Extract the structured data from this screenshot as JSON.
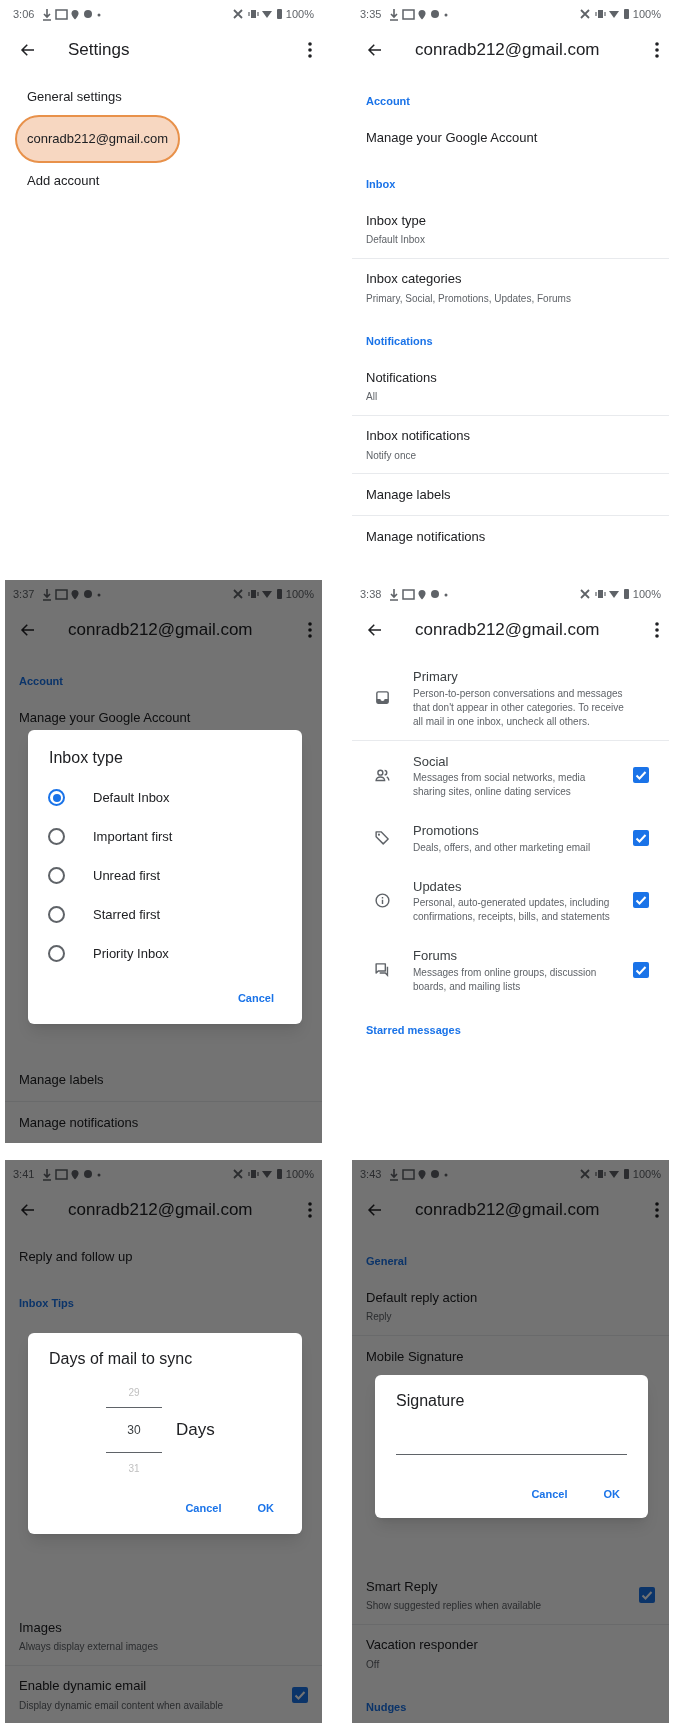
{
  "screens": [
    {
      "status_bar": {
        "time": "3:06",
        "battery": "100%"
      },
      "app_bar": {
        "title": "Settings"
      },
      "items": [
        {
          "kind": "account",
          "label": "General settings",
          "highlighted": false
        },
        {
          "kind": "account",
          "label": "conradb212@gmail.com",
          "highlighted": true
        },
        {
          "kind": "account",
          "label": "Add account",
          "highlighted": false
        }
      ]
    },
    {
      "status_bar": {
        "time": "3:35",
        "battery": "100%"
      },
      "app_bar": {
        "title": "conradb212@gmail.com"
      },
      "items": [
        {
          "kind": "section",
          "label": "Account"
        },
        {
          "kind": "setting",
          "label": "Manage your Google Account"
        },
        {
          "kind": "section",
          "label": "Inbox"
        },
        {
          "kind": "setting",
          "label": "Inbox type",
          "subtitle": "Default Inbox"
        },
        {
          "kind": "setting",
          "label": "Inbox categories",
          "subtitle": "Primary, Social, Promotions, Updates, Forums"
        },
        {
          "kind": "section",
          "label": "Notifications"
        },
        {
          "kind": "setting",
          "label": "Notifications",
          "subtitle": "All"
        },
        {
          "kind": "setting",
          "label": "Inbox notifications",
          "subtitle": "Notify once"
        },
        {
          "kind": "setting",
          "label": "Manage labels"
        },
        {
          "kind": "setting",
          "label": "Manage notifications"
        }
      ]
    },
    {
      "status_bar": {
        "time": "3:37",
        "battery": "100%"
      },
      "app_bar": {
        "title": "conradb212@gmail.com"
      },
      "items": [
        {
          "kind": "section",
          "label": "Account"
        },
        {
          "kind": "setting",
          "label": "Manage your Google Account"
        }
      ],
      "items_below": [
        {
          "kind": "setting",
          "label": "Manage labels"
        },
        {
          "kind": "setting",
          "label": "Manage notifications"
        }
      ],
      "dialog": {
        "kind": "radio",
        "title": "Inbox type",
        "options": [
          {
            "label": "Default Inbox",
            "selected": true
          },
          {
            "label": "Important first",
            "selected": false
          },
          {
            "label": "Unread first",
            "selected": false
          },
          {
            "label": "Starred first",
            "selected": false
          },
          {
            "label": "Priority Inbox",
            "selected": false
          }
        ],
        "buttons": [
          "Cancel"
        ]
      }
    },
    {
      "status_bar": {
        "time": "3:38",
        "battery": "100%"
      },
      "app_bar": {
        "title": "conradb212@gmail.com"
      },
      "items": [
        {
          "kind": "category",
          "label": "Primary",
          "subtitle": "Person-to-person conversations and messages that don't appear in other categories. To receive all mail in one inbox, uncheck all others."
        },
        {
          "kind": "category",
          "label": "Social",
          "subtitle": "Messages from social networks, media sharing sites, online dating services",
          "checked": true
        },
        {
          "kind": "category",
          "label": "Promotions",
          "subtitle": "Deals, offers, and other marketing email",
          "checked": true
        },
        {
          "kind": "category",
          "label": "Updates",
          "subtitle": "Personal, auto-generated updates, including confirmations, receipts, bills, and statements",
          "checked": true
        },
        {
          "kind": "category",
          "label": "Forums",
          "subtitle": "Messages from online groups, discussion boards, and mailing lists",
          "checked": true
        },
        {
          "kind": "section",
          "label": "Starred messages"
        }
      ]
    },
    {
      "status_bar": {
        "time": "3:41",
        "battery": "100%"
      },
      "app_bar": {
        "title": "conradb212@gmail.com"
      },
      "items": [
        {
          "kind": "setting",
          "label": "Reply and follow up"
        },
        {
          "kind": "section",
          "label": "Inbox Tips"
        }
      ],
      "items_below": [
        {
          "kind": "setting",
          "label": "Images",
          "subtitle": "Always display external images"
        },
        {
          "kind": "toggle",
          "label": "Enable dynamic email",
          "subtitle": "Display dynamic email content when available",
          "checked": true
        }
      ],
      "dialog": {
        "kind": "picker",
        "title": "Days of mail to sync",
        "values": [
          {
            "label": "29",
            "selected": false
          },
          {
            "label": "30",
            "selected": true
          },
          {
            "label": "31",
            "selected": false
          }
        ],
        "unit": "Days",
        "buttons": [
          "Cancel",
          "OK"
        ]
      }
    },
    {
      "status_bar": {
        "time": "3:43",
        "battery": "100%"
      },
      "app_bar": {
        "title": "conradb212@gmail.com"
      },
      "items": [
        {
          "kind": "section",
          "label": "General"
        },
        {
          "kind": "setting",
          "label": "Default reply action",
          "subtitle": "Reply"
        },
        {
          "kind": "setting",
          "label": "Mobile Signature"
        }
      ],
      "items_below": [
        {
          "kind": "toggle",
          "label": "Smart Reply",
          "subtitle": "Show suggested replies when available",
          "checked": true
        },
        {
          "kind": "setting",
          "label": "Vacation responder",
          "subtitle": "Off"
        },
        {
          "kind": "section",
          "label": "Nudges"
        }
      ],
      "dialog": {
        "kind": "text_input",
        "title": "Signature",
        "buttons": [
          "Cancel",
          "OK"
        ]
      }
    }
  ]
}
